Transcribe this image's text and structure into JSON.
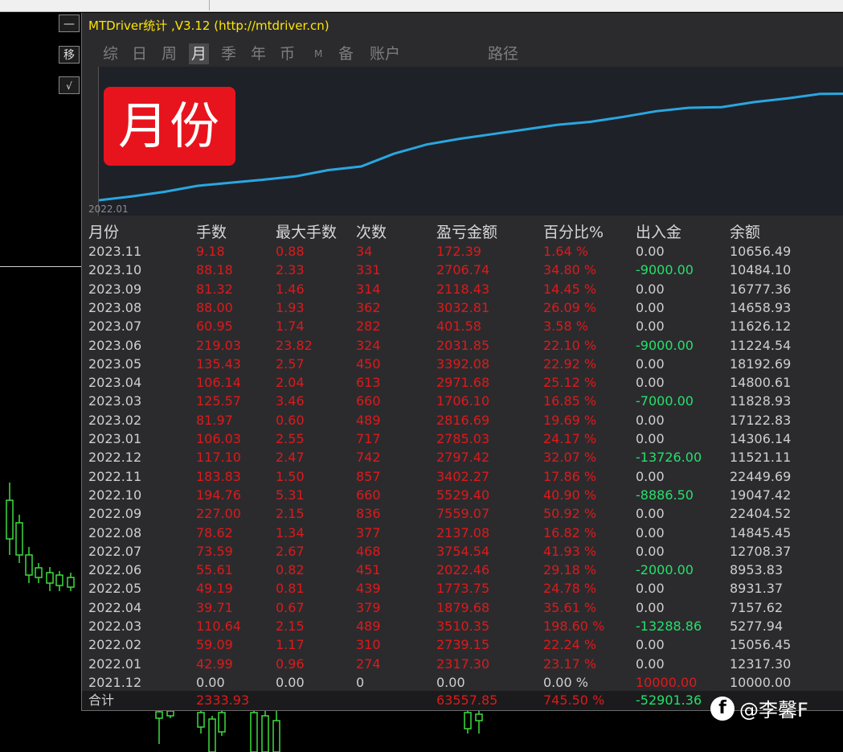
{
  "window": {
    "title": "MTDriver统计 ,V3.12 (http://mtdriver.cn)",
    "side_buttons": [
      "—",
      "移",
      "√"
    ]
  },
  "tabs": [
    {
      "label": "综",
      "active": false
    },
    {
      "label": "日",
      "active": false
    },
    {
      "label": "周",
      "active": false
    },
    {
      "label": "月",
      "active": true
    },
    {
      "label": "季",
      "active": false
    },
    {
      "label": "年",
      "active": false
    },
    {
      "label": "币",
      "active": false
    },
    {
      "label": "M",
      "active": false
    },
    {
      "label": "备",
      "active": false
    },
    {
      "label": "账户",
      "active": false
    },
    {
      "label": "路径",
      "active": false
    }
  ],
  "chart_data": {
    "type": "line",
    "x": [
      "2021.12",
      "2022.01",
      "2022.02",
      "2022.03",
      "2022.04",
      "2022.05",
      "2022.06",
      "2022.07",
      "2022.08",
      "2022.09",
      "2022.10",
      "2022.11",
      "2022.12",
      "2023.01",
      "2023.02",
      "2023.03",
      "2023.04",
      "2023.05",
      "2023.06",
      "2023.07",
      "2023.08",
      "2023.09",
      "2023.10",
      "2023.11"
    ],
    "series": [
      {
        "values": [
          0,
          2317.3,
          5056.45,
          8566.8,
          10446.48,
          12220.23,
          14242.69,
          17997.23,
          20134.31,
          27693.38,
          33222.78,
          36625.05,
          39422.47,
          42207.5,
          45024.19,
          46730.29,
          49701.97,
          53094.05,
          55125.9,
          55527.48,
          58560.29,
          60678.72,
          63385.46,
          63557.85
        ]
      }
    ],
    "tick_labels": [
      "2022.01"
    ],
    "color": "#29a7e0",
    "grid": false
  },
  "badge": {
    "text": "月份",
    "color": "#e8141d"
  },
  "table": {
    "headers": [
      "月份",
      "手数",
      "最大手数",
      "次数",
      "盈亏金额",
      "百分比%",
      "出入金",
      "余额"
    ],
    "rows": [
      {
        "month": "2023.11",
        "lots": "9.18",
        "maxlot": "0.88",
        "count": "34",
        "pnl": "172.39",
        "pct": "1.64 %",
        "flow": "0.00",
        "balance": "10656.49",
        "flow_type": "none"
      },
      {
        "month": "2023.10",
        "lots": "88.18",
        "maxlot": "2.33",
        "count": "331",
        "pnl": "2706.74",
        "pct": "34.80 %",
        "flow": "-9000.00",
        "balance": "10484.10",
        "flow_type": "out"
      },
      {
        "month": "2023.09",
        "lots": "81.32",
        "maxlot": "1.46",
        "count": "314",
        "pnl": "2118.43",
        "pct": "14.45 %",
        "flow": "0.00",
        "balance": "16777.36",
        "flow_type": "none"
      },
      {
        "month": "2023.08",
        "lots": "88.00",
        "maxlot": "1.93",
        "count": "362",
        "pnl": "3032.81",
        "pct": "26.09 %",
        "flow": "0.00",
        "balance": "14658.93",
        "flow_type": "none"
      },
      {
        "month": "2023.07",
        "lots": "60.95",
        "maxlot": "1.74",
        "count": "282",
        "pnl": "401.58",
        "pct": "3.58 %",
        "flow": "0.00",
        "balance": "11626.12",
        "flow_type": "none"
      },
      {
        "month": "2023.06",
        "lots": "219.03",
        "maxlot": "23.82",
        "count": "324",
        "pnl": "2031.85",
        "pct": "22.10 %",
        "flow": "-9000.00",
        "balance": "11224.54",
        "flow_type": "out"
      },
      {
        "month": "2023.05",
        "lots": "135.43",
        "maxlot": "2.57",
        "count": "450",
        "pnl": "3392.08",
        "pct": "22.92 %",
        "flow": "0.00",
        "balance": "18192.69",
        "flow_type": "none"
      },
      {
        "month": "2023.04",
        "lots": "106.14",
        "maxlot": "2.04",
        "count": "613",
        "pnl": "2971.68",
        "pct": "25.12 %",
        "flow": "0.00",
        "balance": "14800.61",
        "flow_type": "none"
      },
      {
        "month": "2023.03",
        "lots": "125.57",
        "maxlot": "3.46",
        "count": "660",
        "pnl": "1706.10",
        "pct": "16.85 %",
        "flow": "-7000.00",
        "balance": "11828.93",
        "flow_type": "out"
      },
      {
        "month": "2023.02",
        "lots": "81.97",
        "maxlot": "0.60",
        "count": "489",
        "pnl": "2816.69",
        "pct": "19.69 %",
        "flow": "0.00",
        "balance": "17122.83",
        "flow_type": "none"
      },
      {
        "month": "2023.01",
        "lots": "106.03",
        "maxlot": "2.55",
        "count": "717",
        "pnl": "2785.03",
        "pct": "24.17 %",
        "flow": "0.00",
        "balance": "14306.14",
        "flow_type": "none"
      },
      {
        "month": "2022.12",
        "lots": "117.10",
        "maxlot": "2.47",
        "count": "742",
        "pnl": "2797.42",
        "pct": "32.07 %",
        "flow": "-13726.00",
        "balance": "11521.11",
        "flow_type": "out"
      },
      {
        "month": "2022.11",
        "lots": "183.83",
        "maxlot": "1.50",
        "count": "857",
        "pnl": "3402.27",
        "pct": "17.86 %",
        "flow": "0.00",
        "balance": "22449.69",
        "flow_type": "none"
      },
      {
        "month": "2022.10",
        "lots": "194.76",
        "maxlot": "5.31",
        "count": "660",
        "pnl": "5529.40",
        "pct": "40.90 %",
        "flow": "-8886.50",
        "balance": "19047.42",
        "flow_type": "out"
      },
      {
        "month": "2022.09",
        "lots": "227.00",
        "maxlot": "2.15",
        "count": "836",
        "pnl": "7559.07",
        "pct": "50.92 %",
        "flow": "0.00",
        "balance": "22404.52",
        "flow_type": "none"
      },
      {
        "month": "2022.08",
        "lots": "78.62",
        "maxlot": "1.34",
        "count": "377",
        "pnl": "2137.08",
        "pct": "16.82 %",
        "flow": "0.00",
        "balance": "14845.45",
        "flow_type": "none"
      },
      {
        "month": "2022.07",
        "lots": "73.59",
        "maxlot": "2.67",
        "count": "468",
        "pnl": "3754.54",
        "pct": "41.93 %",
        "flow": "0.00",
        "balance": "12708.37",
        "flow_type": "none"
      },
      {
        "month": "2022.06",
        "lots": "55.61",
        "maxlot": "0.82",
        "count": "451",
        "pnl": "2022.46",
        "pct": "29.18 %",
        "flow": "-2000.00",
        "balance": "8953.83",
        "flow_type": "out"
      },
      {
        "month": "2022.05",
        "lots": "49.19",
        "maxlot": "0.81",
        "count": "439",
        "pnl": "1773.75",
        "pct": "24.78 %",
        "flow": "0.00",
        "balance": "8931.37",
        "flow_type": "none"
      },
      {
        "month": "2022.04",
        "lots": "39.71",
        "maxlot": "0.67",
        "count": "379",
        "pnl": "1879.68",
        "pct": "35.61 %",
        "flow": "0.00",
        "balance": "7157.62",
        "flow_type": "none"
      },
      {
        "month": "2022.03",
        "lots": "110.64",
        "maxlot": "2.15",
        "count": "489",
        "pnl": "3510.35",
        "pct": "198.60 %",
        "flow": "-13288.86",
        "balance": "5277.94",
        "flow_type": "out"
      },
      {
        "month": "2022.02",
        "lots": "59.09",
        "maxlot": "1.17",
        "count": "310",
        "pnl": "2739.15",
        "pct": "22.24 %",
        "flow": "0.00",
        "balance": "15056.45",
        "flow_type": "none"
      },
      {
        "month": "2022.01",
        "lots": "42.99",
        "maxlot": "0.96",
        "count": "274",
        "pnl": "2317.30",
        "pct": "23.17 %",
        "flow": "0.00",
        "balance": "12317.30",
        "flow_type": "none"
      },
      {
        "month": "2021.12",
        "lots": "0.00",
        "maxlot": "0.00",
        "count": "0",
        "pnl": "0.00",
        "pct": "0.00 %",
        "flow": "10000.00",
        "balance": "10000.00",
        "flow_type": "in"
      }
    ],
    "total": {
      "label": "合计",
      "lots": "2333.93",
      "pnl": "63557.85",
      "pct": "745.50 %",
      "flow": "-52901.36"
    }
  },
  "watermark": {
    "icon": "f",
    "text": "@李馨F"
  },
  "colors": {
    "title": "#ffe600",
    "red": "#dd1a1a",
    "green": "#25e06a",
    "line": "#29a7e0",
    "badge": "#e8141d"
  }
}
